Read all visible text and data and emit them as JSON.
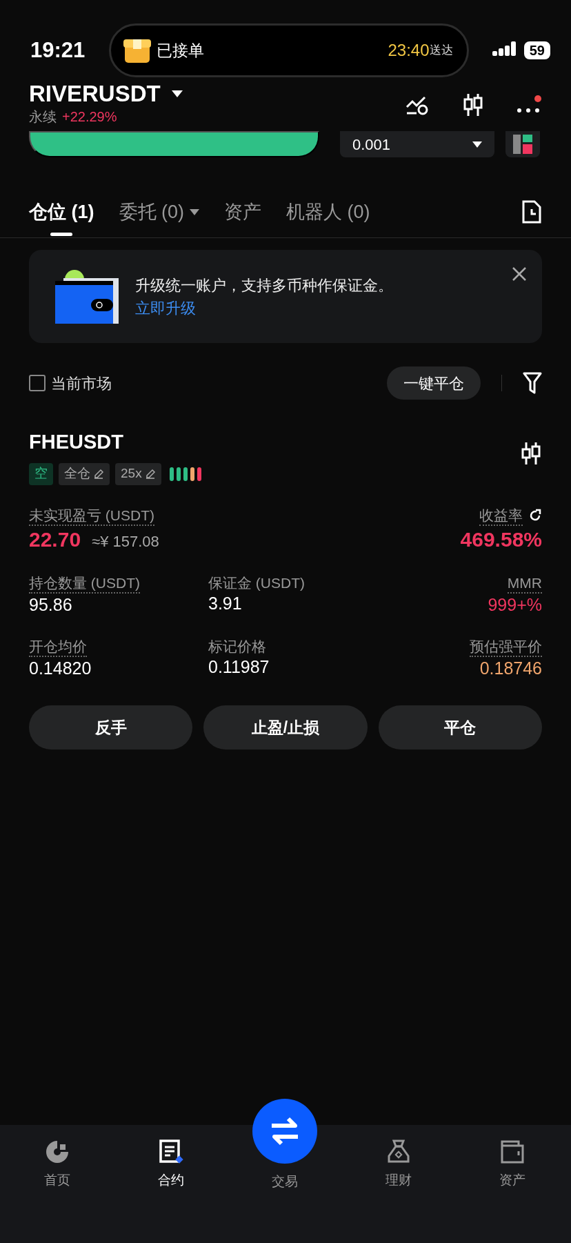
{
  "status_bar": {
    "time": "19:21",
    "activity": {
      "label": "已接单",
      "eta_time": "23:40",
      "eta_suffix": "送达"
    },
    "battery": "59"
  },
  "header": {
    "symbol": "RIVERUSDT",
    "subtitle": "永续",
    "change": "+22.29%",
    "menu_notification": true
  },
  "order_bar": {
    "quantity": "0.001"
  },
  "tabs": [
    {
      "label": "仓位 (1)",
      "selected": true,
      "dropdown": false
    },
    {
      "label": "委托 (0)",
      "selected": false,
      "dropdown": true
    },
    {
      "label": "资产",
      "selected": false,
      "dropdown": false
    },
    {
      "label": "机器人 (0)",
      "selected": false,
      "dropdown": false
    }
  ],
  "banner": {
    "text": "升级统一账户，支持多币种作保证金。",
    "link": "立即升级"
  },
  "filter": {
    "checkbox": {
      "label": "当前市场",
      "checked": false
    },
    "close_all_button": "一键平仓"
  },
  "position": {
    "symbol": "FHEUSDT",
    "tags": [
      {
        "kind": "side",
        "label": "空"
      },
      {
        "kind": "editable",
        "label": "全仓"
      },
      {
        "kind": "editable",
        "label": "25x"
      }
    ],
    "risk_bars": [
      {
        "color": "#2ebd85"
      },
      {
        "color": "#2ebd85"
      },
      {
        "color": "#2ebd85"
      },
      {
        "color": "#f0a56c"
      },
      {
        "color": "#f0365f"
      }
    ],
    "metric_rows": [
      [
        {
          "label": "未实现盈亏 (USDT)",
          "value": "22.70",
          "note": "≈¥ 157.08",
          "color": "#f0365f",
          "tooltip": true,
          "share": false
        },
        {
          "label": "收益率",
          "value": "469.58%",
          "color": "#f0365f",
          "tooltip": true,
          "share": true
        }
      ],
      [
        {
          "label": "持仓数量 (USDT)",
          "value": "95.86",
          "color": "#ffffff",
          "tooltip": true,
          "share": false
        },
        {
          "label": "保证金 (USDT)",
          "value": "3.91",
          "color": "#ffffff",
          "tooltip": false,
          "share": false
        },
        {
          "label": "MMR",
          "value": "999+%",
          "color": "#f0365f",
          "tooltip": true,
          "share": false
        }
      ],
      [
        {
          "label": "开仓均价",
          "value": "0.14820",
          "color": "#ffffff",
          "tooltip": true,
          "share": false
        },
        {
          "label": "标记价格",
          "value": "0.11987",
          "color": "#ffffff",
          "tooltip": false,
          "share": false
        },
        {
          "label": "预估强平价",
          "value": "0.18746",
          "color": "#f0a56c",
          "tooltip": true,
          "share": false
        }
      ]
    ],
    "actions": [
      "反手",
      "止盈/止损",
      "平仓"
    ]
  },
  "bottom_nav": [
    {
      "kind": "home",
      "label": "首页",
      "selected": false
    },
    {
      "kind": "contract",
      "label": "合约",
      "selected": true
    },
    {
      "kind": "trade",
      "label": "交易",
      "selected": false
    },
    {
      "kind": "finance",
      "label": "理财",
      "selected": false
    },
    {
      "kind": "assets",
      "label": "资产",
      "selected": false
    }
  ]
}
